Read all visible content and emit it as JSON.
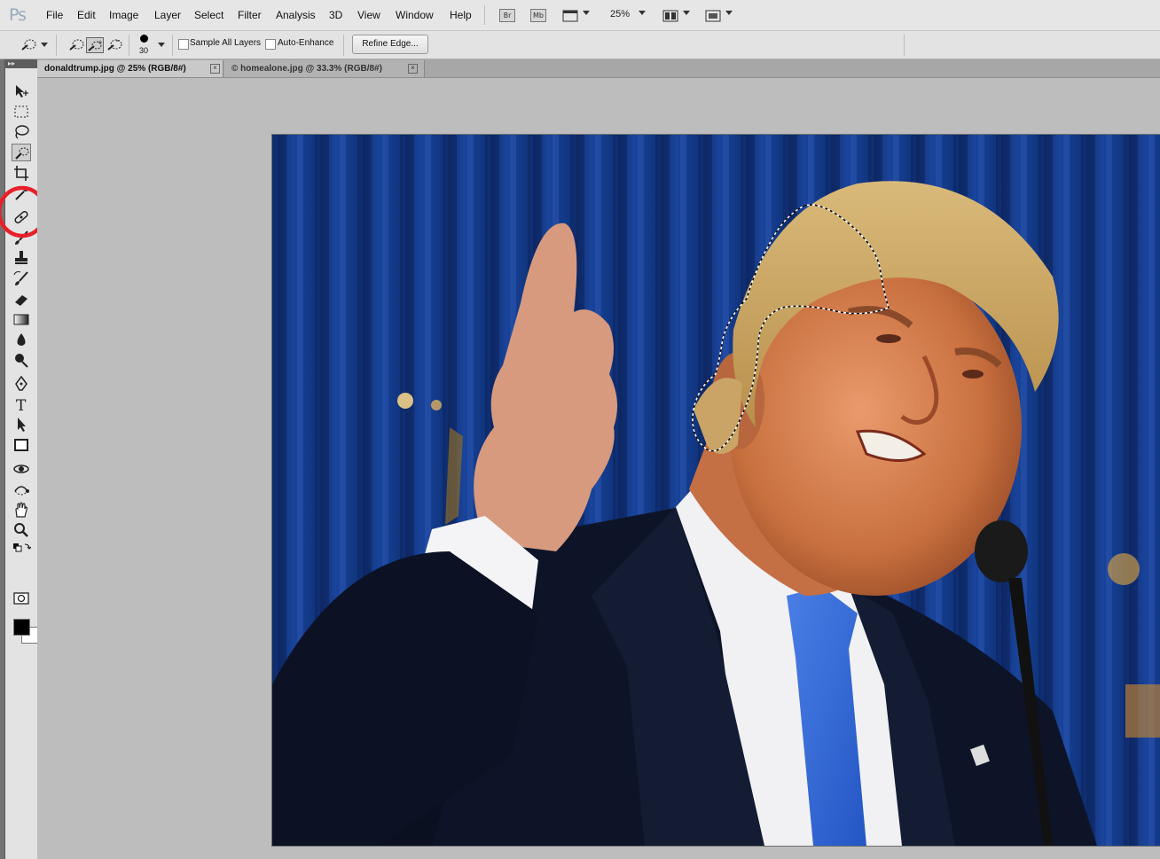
{
  "app": {
    "logo": "Ps"
  },
  "menu": [
    "File",
    "Edit",
    "Image",
    "Layer",
    "Select",
    "Filter",
    "Analysis",
    "3D",
    "View",
    "Window",
    "Help"
  ],
  "app_bar": {
    "bridge_label": "Br",
    "minibridge_label": "Mb",
    "zoom": "25%"
  },
  "options": {
    "brush_size": "30",
    "sample_all_layers_label": "Sample All Layers",
    "sample_all_layers_checked": false,
    "auto_enhance_label": "Auto-Enhance",
    "auto_enhance_checked": false,
    "refine_edge_label": "Refine Edge..."
  },
  "tabs": [
    {
      "label": "donaldtrump.jpg @ 25% (RGB/8#)",
      "active": true
    },
    {
      "label": "© homealone.jpg @ 33.3% (RGB/8#)",
      "active": false
    }
  ],
  "toolbox": {
    "collapse_label": "▸▸",
    "selected_tool": "quick-selection"
  },
  "colors": {
    "foreground": "#000000",
    "background": "#ffffff",
    "highlight": "#e8202a"
  }
}
